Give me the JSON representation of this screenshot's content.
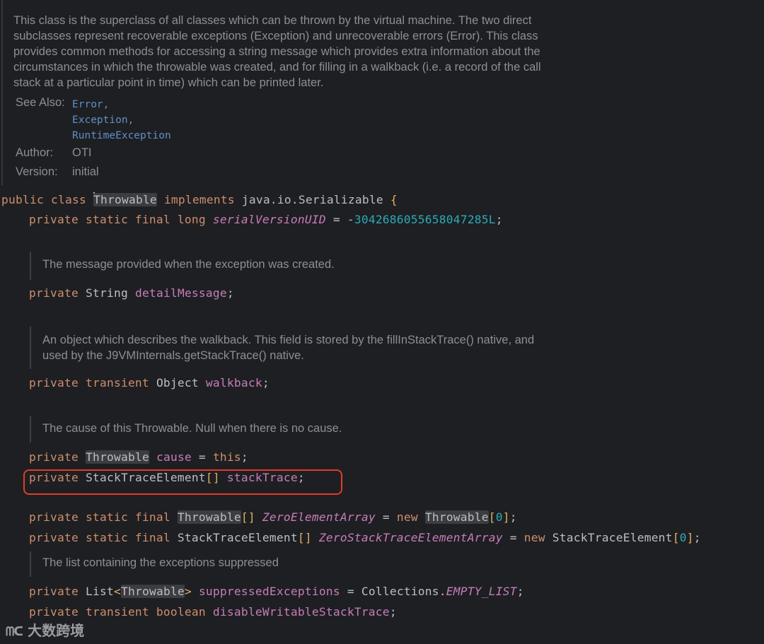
{
  "doc": {
    "lines": [
      "This class is the superclass of all classes which can be thrown by the virtual machine. The two direct",
      "subclasses represent recoverable exceptions (Exception) and unrecoverable errors (Error). This class",
      "provides common methods for accessing a string message which provides extra information about the",
      "circumstances in which the throwable was created, and for filling in a walkback (i.e. a record of the call",
      "stack at a particular point in time) which can be printed later."
    ],
    "see_also_label": "See Also:",
    "see_also": [
      "Error,",
      "Exception,",
      "RuntimeException"
    ],
    "author_label": "Author:",
    "author": "OTI",
    "version_label": "Version:",
    "version": "initial"
  },
  "code": {
    "class_decl": {
      "public": "public",
      "class": "class",
      "name": "Throwable",
      "implements": "implements",
      "iface": "java.io.Serializable",
      "brace": "{"
    },
    "serial": {
      "mods": "private static final long",
      "name": "serialVersionUID",
      "eq": " = -",
      "value": "3042686055658047285L",
      "end": ";"
    },
    "comment_message": "The message provided when the exception was created.",
    "detail": {
      "mods": "private",
      "type": "String",
      "name": "detailMessage",
      "end": ";"
    },
    "comment_walkback": [
      "An object which describes the walkback. This field is stored by the fillInStackTrace() native, and",
      "used by the J9VMInternals.getStackTrace() native."
    ],
    "walkback": {
      "mods": "private transient",
      "type": "Object",
      "name": "walkback",
      "end": ";"
    },
    "comment_cause": "The cause of this Throwable. Null when there is no cause.",
    "cause": {
      "mods": "private",
      "type": "Throwable",
      "name": "cause",
      "eq": " = ",
      "value": "this",
      "end": ";"
    },
    "stack": {
      "mods": "private",
      "type": "StackTraceElement",
      "brk": "[]",
      "name": "stackTrace",
      "end": ";"
    },
    "zero1": {
      "mods": "private static final",
      "type": "Throwable",
      "brk": "[]",
      "name": "ZeroElementArray",
      "eq": " = ",
      "new": "new",
      "type2": "Throwable",
      "open": "[",
      "num": "0",
      "close": "]",
      "end": ";"
    },
    "zero2": {
      "mods": "private static final",
      "type": "StackTraceElement",
      "brk": "[]",
      "name": "ZeroStackTraceElementArray",
      "eq": " = ",
      "new": "new",
      "type2": "StackTraceElement",
      "open": "[",
      "num": "0",
      "close": "]",
      "end": ";"
    },
    "comment_suppressed": "The list containing the exceptions suppressed",
    "suppressed": {
      "mods": "private",
      "type": "List",
      "lt": "<",
      "generic": "Throwable",
      "gt": ">",
      "name": "suppressedExceptions",
      "eq": " = Collections.",
      "value": "EMPTY_LIST",
      "end": ";"
    },
    "disable": {
      "mods": "private transient boolean",
      "name": "disableWritableStackTrace",
      "end": ";"
    }
  },
  "watermark": "大数跨境"
}
